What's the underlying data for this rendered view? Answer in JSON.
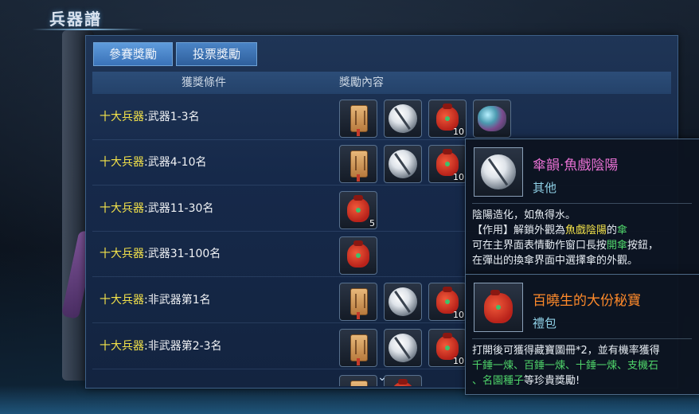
{
  "page": {
    "title": "兵器譜"
  },
  "tabs": [
    {
      "label": "參賽獎勵"
    },
    {
      "label": "投票獎勵"
    }
  ],
  "table": {
    "headers": {
      "condition": "獲獎條件",
      "reward": "獎勵內容"
    },
    "rows": [
      {
        "prefix": "十大兵器",
        "rest": ":武器1-3名",
        "items": [
          {
            "icon": "token-icon",
            "count": ""
          },
          {
            "icon": "umbrella-icon",
            "count": ""
          },
          {
            "icon": "red-bag-icon",
            "count": "10"
          },
          {
            "icon": "spirit-stone-icon",
            "count": ""
          }
        ]
      },
      {
        "prefix": "十大兵器",
        "rest": ":武器4-10名",
        "items": [
          {
            "icon": "token-icon",
            "count": ""
          },
          {
            "icon": "umbrella-icon",
            "count": ""
          },
          {
            "icon": "red-bag-icon",
            "count": "10"
          }
        ]
      },
      {
        "prefix": "十大兵器",
        "rest": ":武器11-30名",
        "items": [
          {
            "icon": "red-bag-icon",
            "count": "5"
          }
        ]
      },
      {
        "prefix": "十大兵器",
        "rest": ":武器31-100名",
        "items": [
          {
            "icon": "red-bag-icon",
            "count": ""
          }
        ]
      },
      {
        "prefix": "十大兵器",
        "rest": ":非武器第1名",
        "items": [
          {
            "icon": "token-icon",
            "count": ""
          },
          {
            "icon": "umbrella-icon",
            "count": ""
          },
          {
            "icon": "red-bag-icon",
            "count": "10"
          }
        ]
      },
      {
        "prefix": "十大兵器",
        "rest": ":非武器第2-3名",
        "items": [
          {
            "icon": "token-icon",
            "count": ""
          },
          {
            "icon": "umbrella-icon",
            "count": ""
          },
          {
            "icon": "red-bag-icon",
            "count": "10"
          }
        ]
      }
    ]
  },
  "tooltip_umbrella": {
    "name": "傘韻·魚戲陰陽",
    "type": "其他",
    "line1": "陰陽造化，如魚得水。",
    "line2_a": "【作用】解鎖外觀為",
    "line2_b": "魚戲陰陽",
    "line2_c": "的",
    "line2_d": "傘",
    "line3_a": "可在主界面表情動作窗口長按",
    "line3_b": "開傘",
    "line3_c": "按鈕，",
    "line4": "在彈出的換傘界面中選擇傘的外觀。"
  },
  "tooltip_bag": {
    "name": "百曉生的大份秘寶",
    "type": "禮包",
    "line1": "打開後可獲得藏寶圖冊*2，並有機率獲得",
    "line2_green": "千錘一煉、百錘一煉、十錘一煉、支機石",
    "line3_green": "、名園種子",
    "line3_rest": "等珍貴獎勵!"
  },
  "colors": {
    "highlight_yellow": "#f3e24a",
    "name_pink": "#e770d2",
    "name_orange": "#ff8a2a",
    "green_text": "#4fd46a",
    "tab_blue": "#4a84c6"
  }
}
